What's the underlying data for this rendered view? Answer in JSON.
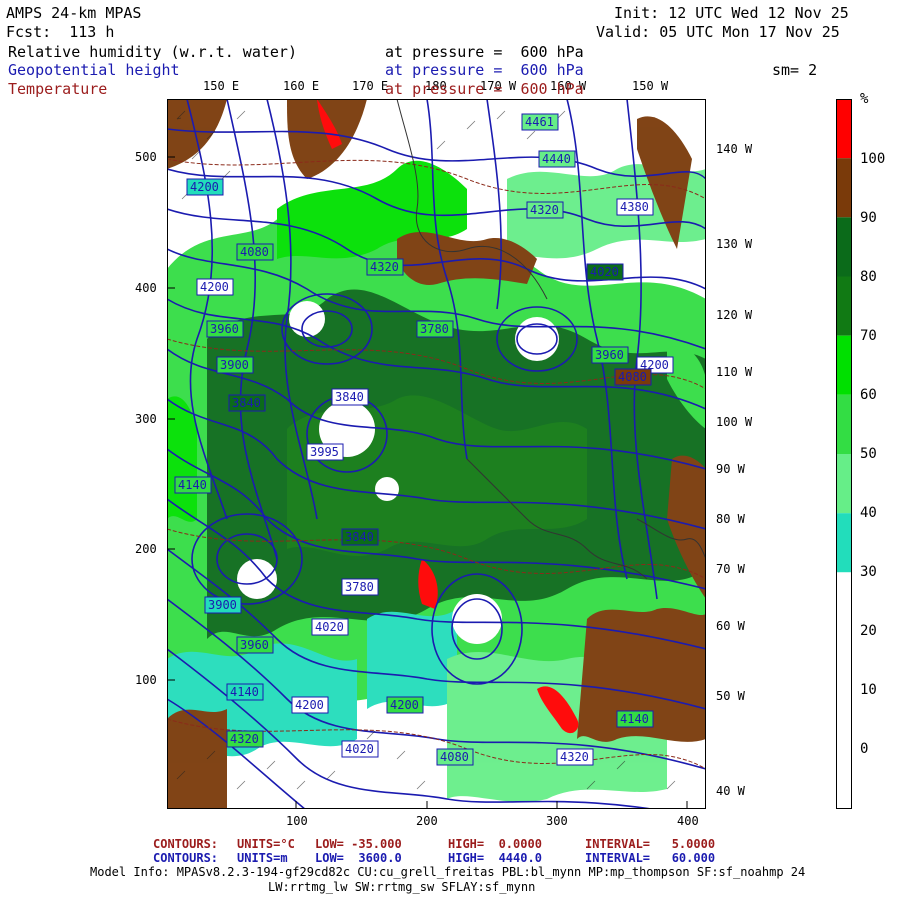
{
  "header": {
    "model_title": "AMPS 24-km MPAS",
    "forecast": "Fcst:  113 h",
    "init": "Init: 12 UTC Wed 12 Nov 25",
    "valid": "Valid: 05 UTC Mon 17 Nov 25",
    "fields": [
      {
        "name": "Relative humidity (w.r.t. water)",
        "level": "at pressure =  600 hPa",
        "color": "#000000"
      },
      {
        "name": "Geopotential height",
        "level": "at pressure =  600 hPa",
        "color": "#1b1bb0"
      },
      {
        "name": "Temperature",
        "level": "at pressure =  600 hPa",
        "color": "#9b1c1c"
      }
    ],
    "smoothing": "sm= 2"
  },
  "axes": {
    "left_ticks": [
      "500",
      "400",
      "300",
      "200",
      "100"
    ],
    "bottom_ticks": [
      "100",
      "200",
      "300",
      "400"
    ],
    "top_longitudes": [
      "150 E",
      "160 E",
      "170 E",
      "180",
      "170 W",
      "160 W",
      "150 W"
    ],
    "right_longitudes": [
      "140 W",
      "130 W",
      "120 W",
      "110 W",
      "100 W",
      "90 W",
      "80 W",
      "70 W",
      "60 W",
      "50 W",
      "40 W"
    ]
  },
  "colorbar": {
    "unit": "%",
    "labels": [
      "100",
      "90",
      "80",
      "70",
      "60",
      "50",
      "40",
      "30",
      "20",
      "10",
      "0"
    ],
    "bands": [
      {
        "from": 100,
        "to": 110,
        "color": "#ff0000"
      },
      {
        "from": 90,
        "to": 100,
        "color": "#7a3a0a"
      },
      {
        "from": 80,
        "to": 90,
        "color": "#0b6b1a"
      },
      {
        "from": 70,
        "to": 80,
        "color": "#117a14"
      },
      {
        "from": 60,
        "to": 70,
        "color": "#00e000"
      },
      {
        "from": 50,
        "to": 60,
        "color": "#33dd44"
      },
      {
        "from": 40,
        "to": 50,
        "color": "#66ee88"
      },
      {
        "from": 30,
        "to": 40,
        "color": "#22ddbb"
      },
      {
        "from": -10,
        "to": 30,
        "color": "#ffffff"
      }
    ]
  },
  "height_labels": [
    "4461",
    "4440",
    "4380",
    "4320",
    "4200",
    "4080",
    "4320",
    "4200",
    "4020",
    "3960",
    "3900",
    "3840",
    "3995",
    "3840",
    "3780",
    "3840",
    "3960",
    "4140",
    "4200",
    "3900",
    "4020",
    "4140",
    "4200",
    "4080",
    "4320",
    "4140",
    "4320",
    "4200",
    "3780",
    "3960",
    "4020",
    "4080"
  ],
  "footer": {
    "line1": {
      "label": "CONTOURS:",
      "units": "UNITS=°C",
      "low": "LOW= -35.000",
      "high": "HIGH=  0.0000",
      "interval": "INTERVAL=   5.0000",
      "color": "#9b1c1c"
    },
    "line2": {
      "label": "CONTOURS:",
      "units": "UNITS=m",
      "low": "LOW=  3600.0",
      "high": "HIGH=  4440.0",
      "interval": "INTERVAL=   60.000",
      "color": "#1b1bb0"
    },
    "model_info_1": "Model Info: MPASv8.2.3-194-gf29cd82c CU:cu_grell_freitas PBL:bl_mynn MP:mp_thompson SF:sf_noahmp 24",
    "model_info_2": "LW:rrtmg_lw SW:rrtmg_sw SFLAY:sf_mynn"
  }
}
